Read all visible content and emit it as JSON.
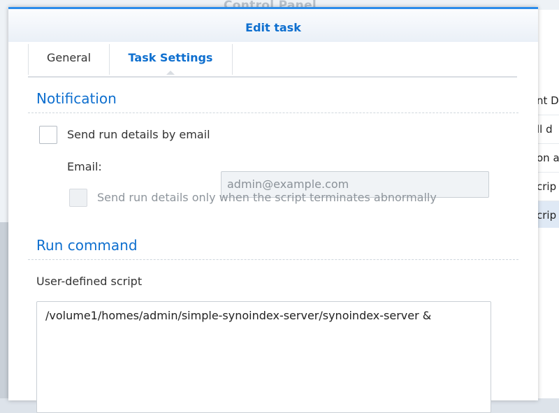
{
  "background_window": {
    "title": "Control Panel",
    "list_items": [
      "nt D",
      "ll d",
      "on a",
      "crip",
      "crip"
    ]
  },
  "dialog": {
    "title": "Edit task",
    "tabs": [
      {
        "label": "General",
        "active": false
      },
      {
        "label": "Task Settings",
        "active": true
      }
    ]
  },
  "notification": {
    "section_title": "Notification",
    "send_email": {
      "label": "Send run details by email",
      "checked": false
    },
    "email_label": "Email:",
    "email_placeholder": "admin@example.com",
    "abnormal_only": {
      "label": "Send run details only when the script terminates abnormally",
      "checked": false,
      "disabled": true
    }
  },
  "run_command": {
    "section_title": "Run command",
    "script_label": "User-defined script",
    "script_value": "/volume1/homes/admin/simple-synoindex-server/synoindex-server &"
  },
  "colors": {
    "accent": "#0e6fcf",
    "header_border": "#2a8ceb"
  }
}
